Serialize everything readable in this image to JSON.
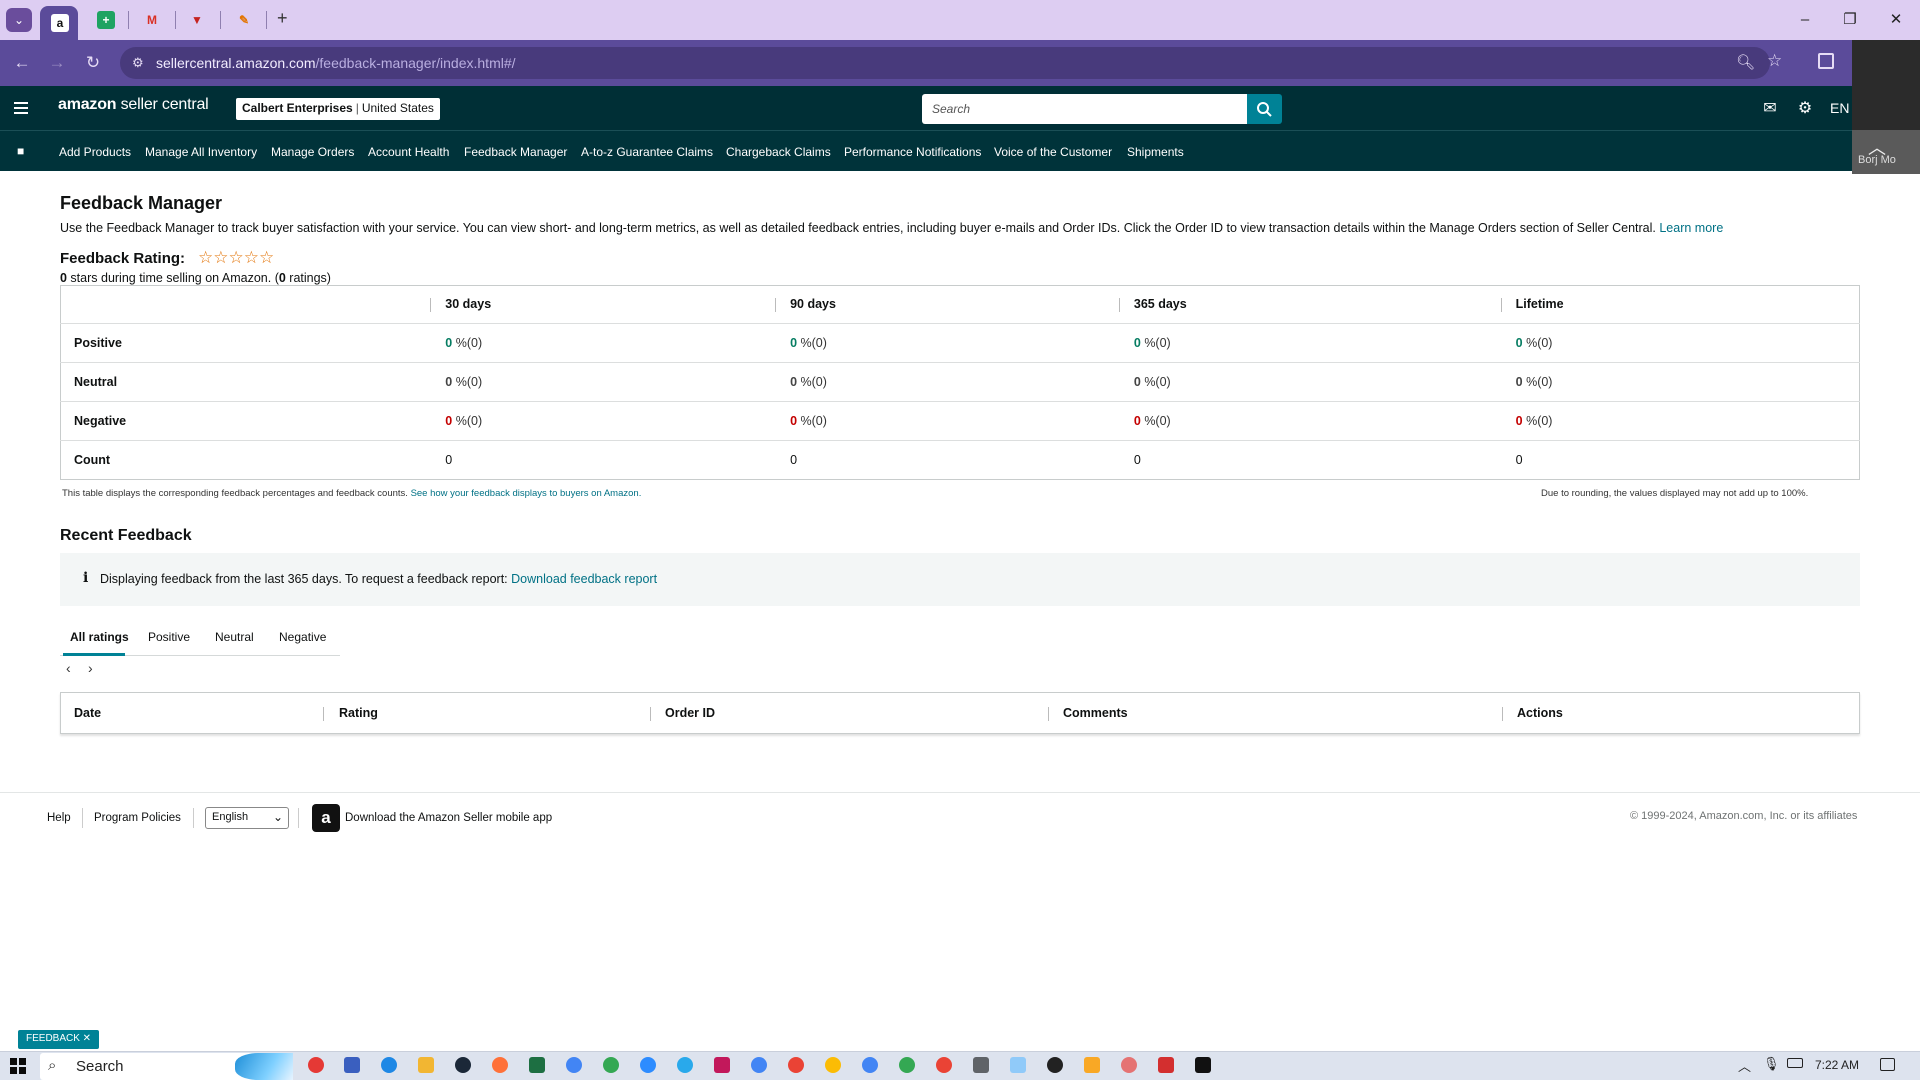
{
  "browser": {
    "url_host": "sellercentral.amazon.com",
    "url_path": "/feedback-manager/index.html#/",
    "tabs": [
      {
        "icon": "amazon-icon",
        "label": "a",
        "color": "#ffffff"
      },
      {
        "icon": "sheets-icon",
        "label": "+",
        "color": "#1ea362"
      },
      {
        "icon": "gmail-icon",
        "label": "M",
        "color": "#d93025"
      },
      {
        "icon": "shield-icon",
        "label": "▼",
        "color": "#c5221f"
      },
      {
        "icon": "app-icon",
        "label": "✎",
        "color": "#e37400"
      }
    ],
    "new_tab": "+"
  },
  "header": {
    "logo_brand": "amazon",
    "logo_product": "seller central",
    "account_name": "Calbert Enterprises",
    "account_region": "United States",
    "search_placeholder": "Search",
    "lang": "EN",
    "side_panel_text": "Borj Mo"
  },
  "nav": [
    "Add Products",
    "Manage All Inventory",
    "Manage Orders",
    "Account Health",
    "Feedback Manager",
    "A-to-z Guarantee Claims",
    "Chargeback Claims",
    "Performance Notifications",
    "Voice of the Customer",
    "Shipments"
  ],
  "main": {
    "title": "Feedback Manager",
    "intro": "Use the Feedback Manager to track buyer satisfaction with your service. You can view short- and long-term metrics, as well as detailed feedback entries, including buyer e-mails and Order IDs. Click the Order ID to view transaction details within the Manage Orders section of Seller Central.",
    "learn_more": "Learn more",
    "rating_label": "Feedback Rating:",
    "stars": "☆☆☆☆☆",
    "stars_value": "0",
    "rating_sub_mid": " stars during time selling on Amazon. (",
    "ratings_count": "0",
    "rating_sub_end": " ratings)"
  },
  "metrics": {
    "columns": [
      "30 days",
      "90 days",
      "365 days",
      "Lifetime"
    ],
    "rows": [
      {
        "label": "Positive",
        "cells": [
          {
            "v": "0",
            "p": " %(0)"
          },
          {
            "v": "0",
            "p": " %(0)"
          },
          {
            "v": "0",
            "p": " %(0)"
          },
          {
            "v": "0",
            "p": " %(0)"
          }
        ]
      },
      {
        "label": "Neutral",
        "cells": [
          {
            "v": "0",
            "p": " %(0)"
          },
          {
            "v": "0",
            "p": " %(0)"
          },
          {
            "v": "0",
            "p": " %(0)"
          },
          {
            "v": "0",
            "p": " %(0)"
          }
        ]
      },
      {
        "label": "Negative",
        "cells": [
          {
            "v": "0",
            "p": " %(0)"
          },
          {
            "v": "0",
            "p": " %(0)"
          },
          {
            "v": "0",
            "p": " %(0)"
          },
          {
            "v": "0",
            "p": " %(0)"
          }
        ]
      },
      {
        "label": "Count",
        "cells": [
          {
            "v": "0",
            "p": ""
          },
          {
            "v": "0",
            "p": ""
          },
          {
            "v": "0",
            "p": ""
          },
          {
            "v": "0",
            "p": ""
          }
        ]
      }
    ],
    "note": "This table displays the corresponding feedback percentages and feedback counts.",
    "note_link": "See how your feedback displays to buyers on Amazon.",
    "rounding_note": "Due to rounding, the values displayed may not add up to 100%."
  },
  "recent": {
    "title": "Recent Feedback",
    "info_icon": "i",
    "info_text": "Displaying feedback from the last 365 days. To request a feedback report:",
    "info_link": "Download feedback report",
    "tabs": [
      "All ratings",
      "Positive",
      "Neutral",
      "Negative"
    ],
    "prev": "‹",
    "next": "›",
    "columns": [
      "Date",
      "Rating",
      "Order ID",
      "Comments",
      "Actions"
    ]
  },
  "footer": {
    "help": "Help",
    "policies": "Program Policies",
    "language": "English",
    "app_icon": "a",
    "app_text": "Download the Amazon Seller mobile app",
    "copyright": "© 1999-2024, Amazon.com, Inc. or its affiliates",
    "feedback_btn": "FEEDBACK ✕"
  },
  "taskbar": {
    "search": "Search",
    "time": "7:22 AM"
  }
}
